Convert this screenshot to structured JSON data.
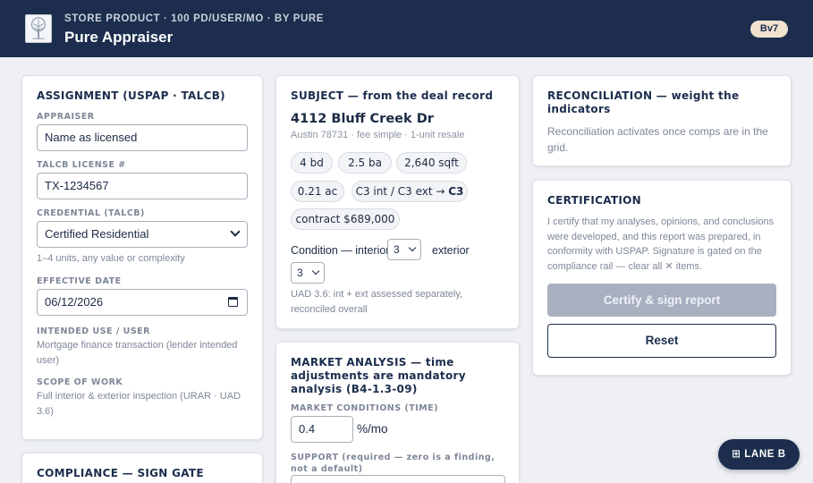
{
  "header": {
    "breadcrumb": "STORE PRODUCT · 100 PD/USER/MO · BY PURE",
    "title": "Pure Appraiser",
    "version_badge": "Bv7",
    "logo_icon": "tree-logo-icon"
  },
  "assignment": {
    "title": "ASSIGNMENT (USPAP · TALCB)",
    "appraiser_label": "APPRAISER",
    "appraiser_value": "Name as licensed",
    "license_label": "TALCB LICENSE #",
    "license_value": "TX-1234567",
    "credential_label": "CREDENTIAL (TALCB)",
    "credential_value": "Certified Residential",
    "credential_help": "1–4 units, any value or complexity",
    "date_label": "EFFECTIVE DATE",
    "date_value": "06/12/2026",
    "use_label": "INTENDED USE / USER",
    "use_value": "Mortgage finance transaction (lender intended user)",
    "scope_label": "SCOPE OF WORK",
    "scope_value": "Full interior & exterior inspection (URAR · UAD 3.6)"
  },
  "compliance": {
    "title": "COMPLIANCE — SIGN GATE"
  },
  "subject": {
    "title": "SUBJECT — from the deal record",
    "address": "4112 Bluff Creek Dr",
    "meta": "Austin 78731 · fee simple · 1-unit resale",
    "pills": {
      "beds": "4 bd",
      "baths": "2.5 ba",
      "sqft": "2,640 sqft",
      "acres": "0.21 ac",
      "condition_prefix": "C3 int / C3 ext → ",
      "condition_result": "C3",
      "contract": "contract $689,000"
    },
    "condition_label": "Condition — interior",
    "interior_value": "3",
    "exterior_label": "exterior",
    "exterior_value": "3",
    "note": "UAD 3.6: int + ext assessed separately, reconciled overall"
  },
  "market": {
    "title": "MARKET ANALYSIS — time adjustments are mandatory analysis (B4-1.3-09)",
    "conditions_label": "MARKET CONDITIONS (TIME)",
    "conditions_value": "0.4",
    "conditions_unit": "%/mo",
    "support_label": "SUPPORT (required — zero is a finding, not a default)"
  },
  "reconciliation": {
    "title": "RECONCILIATION — weight the indicators",
    "body": "Reconciliation activates once comps are in the grid."
  },
  "certification": {
    "title": "CERTIFICATION",
    "body": "I certify that my analyses, opinions, and conclusions were developed, and this report was prepared, in conformity with USPAP. Signature is gated on the compliance rail — clear all ✕ items.",
    "sign_button": "Certify & sign report",
    "reset_button": "Reset"
  },
  "lane_button": "⊞ LANE B"
}
